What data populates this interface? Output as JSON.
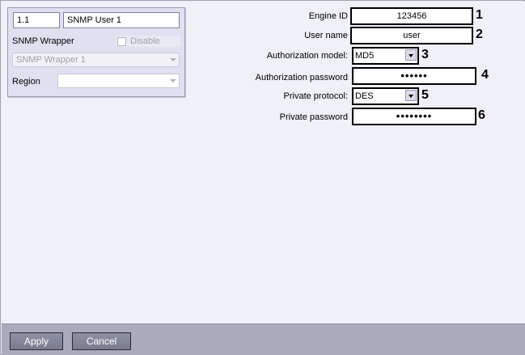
{
  "left_panel": {
    "id_value": "1.1",
    "name_value": "SNMP User 1",
    "wrapper_label": "SNMP Wrapper",
    "disable_label": "Disable",
    "wrapper_value": "SNMP Wrapper 1",
    "region_label": "Region",
    "region_value": ""
  },
  "form": {
    "engine_id": {
      "label": "Engine ID",
      "value": "123456",
      "marker": "1"
    },
    "user_name": {
      "label": "User name",
      "value": "user",
      "marker": "2"
    },
    "auth_model": {
      "label": "Authorization model:",
      "value": "MD5",
      "marker": "3"
    },
    "auth_password": {
      "label": "Authorization password",
      "value": "••••••",
      "marker": "4"
    },
    "priv_protocol": {
      "label": "Private protocol:",
      "value": "DES",
      "marker": "5"
    },
    "priv_password": {
      "label": "Private password",
      "value": "••••••••",
      "marker": "6"
    }
  },
  "bottom": {
    "apply_label": "Apply",
    "cancel_label": "Cancel"
  },
  "colors": {
    "background": "#eff0f8",
    "panel": "#dfe1f0",
    "bottom_bar": "#a9abbd",
    "button": "#7f8195"
  }
}
